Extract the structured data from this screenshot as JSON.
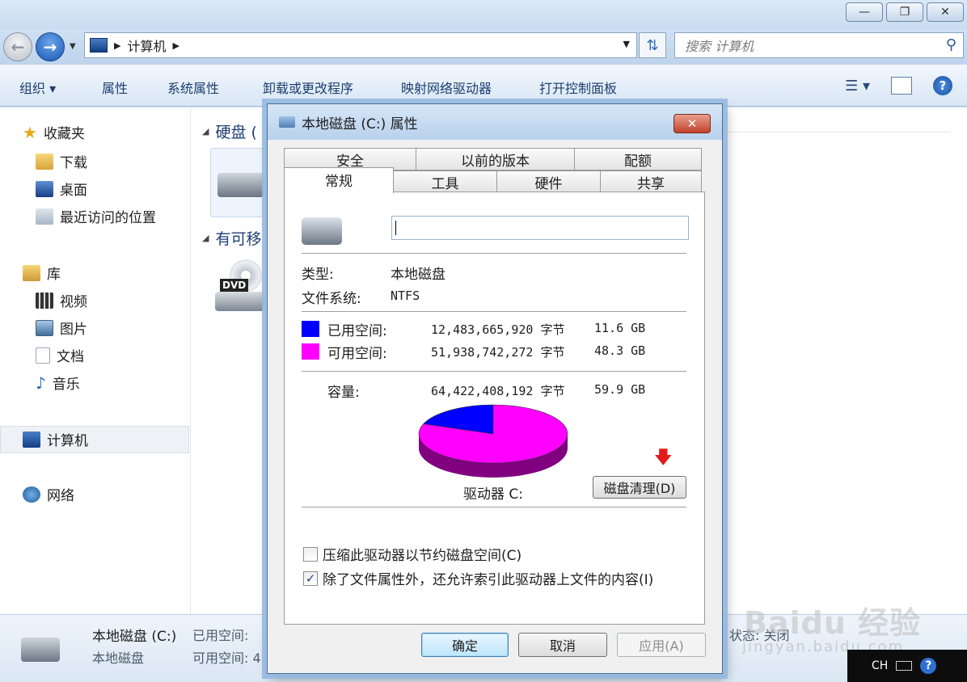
{
  "window": {
    "minimize": "—",
    "maximize": "❐",
    "close": "✕"
  },
  "nav": {
    "breadcrumb": "计算机",
    "search_placeholder": "搜索 计算机"
  },
  "toolbar": {
    "organize": "组织 ▾",
    "properties": "属性",
    "system_properties": "系统属性",
    "uninstall": "卸载或更改程序",
    "map_drive": "映射网络驱动器",
    "control_panel": "打开控制面板"
  },
  "sidebar": {
    "favorites": "收藏夹",
    "downloads": "下载",
    "desktop": "桌面",
    "recent": "最近访问的位置",
    "libraries": "库",
    "videos": "视频",
    "pictures": "图片",
    "documents": "文档",
    "music": "音乐",
    "computer": "计算机",
    "network": "网络"
  },
  "content": {
    "hard_disks": "硬盘 (",
    "removable": "有可移",
    "dvd_label": "DVD"
  },
  "details": {
    "name": "本地磁盘 (C:)",
    "type": "本地磁盘",
    "used_label": "已用空间:",
    "free_label": "可用空间: 4",
    "status": "状态: 关闭"
  },
  "tray": {
    "lang": "CH"
  },
  "watermark": {
    "main": "Baidu 经验",
    "url": "jingyan.baidu.com"
  },
  "dialog": {
    "title": "本地磁盘 (C:) 属性",
    "tabs_top": [
      "安全",
      "以前的版本",
      "配额"
    ],
    "tabs_bottom": [
      "常规",
      "工具",
      "硬件",
      "共享"
    ],
    "name_value": "",
    "type_label": "类型:",
    "type_value": "本地磁盘",
    "fs_label": "文件系统:",
    "fs_value": "NTFS",
    "used": {
      "label": "已用空间:",
      "bytes": "12,483,665,920 字节",
      "size": "11.6 GB",
      "color": "#0000ff"
    },
    "free": {
      "label": "可用空间:",
      "bytes": "51,938,742,272 字节",
      "size": "48.3 GB",
      "color": "#ff00ff"
    },
    "capacity": {
      "label": "容量:",
      "bytes": "64,422,408,192 字节",
      "size": "59.9 GB"
    },
    "drive_label": "驱动器 C:",
    "cleanup_button": "磁盘清理(D)",
    "compress_label": "压缩此驱动器以节约磁盘空间(C)",
    "compress_checked": false,
    "index_label": "除了文件属性外，还允许索引此驱动器上文件的内容(I)",
    "index_checked": true,
    "ok": "确定",
    "cancel": "取消",
    "apply": "应用(A)"
  },
  "chart_data": {
    "type": "pie",
    "categories": [
      "已用空间",
      "可用空间"
    ],
    "values": [
      11.6,
      48.3
    ],
    "colors": [
      "#0000ff",
      "#ff00ff"
    ]
  }
}
